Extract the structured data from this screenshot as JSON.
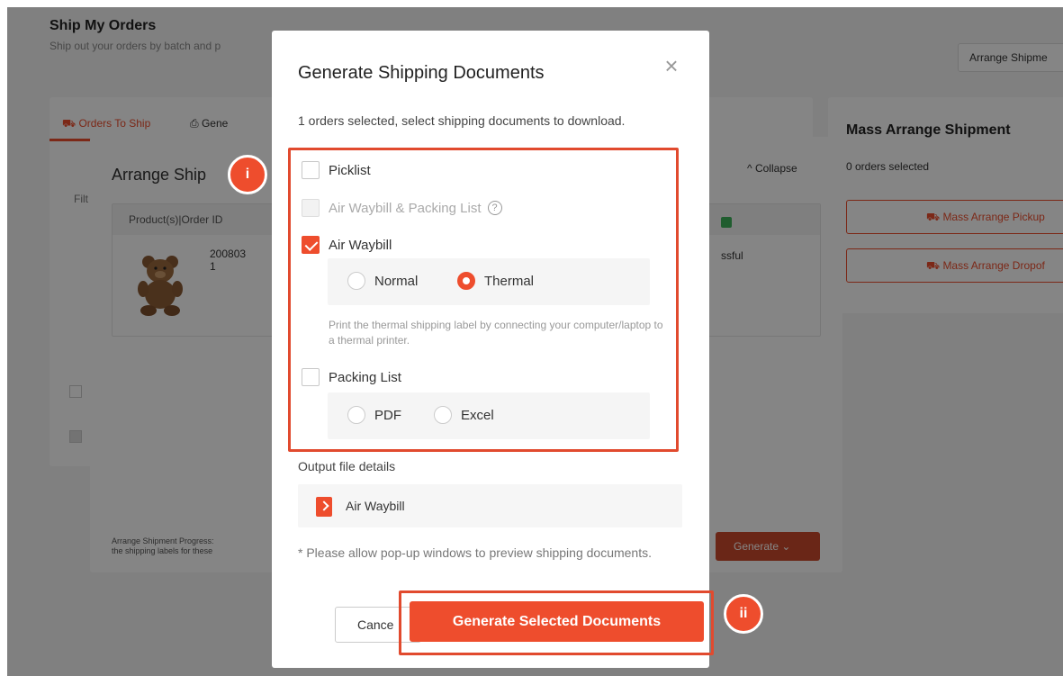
{
  "background": {
    "page_title": "Ship My Orders",
    "page_subtitle": "Ship out your orders by batch and p",
    "arrange_shipment_button": "Arrange Shipme",
    "tabs": [
      {
        "label": "Orders To Ship"
      },
      {
        "label": "Gene"
      }
    ],
    "mass_arrange": {
      "title": "Mass Arrange Shipment",
      "orders_selected": "0 orders selected",
      "pickup_button": "Mass Arrange Pickup",
      "dropoff_button": "Mass Arrange Dropof"
    },
    "arrange_modal": {
      "title": "Arrange Ship",
      "collapse_label": "Collapse",
      "filter_label": "Filt",
      "table_header": "Product(s)|Order ID",
      "order_id": "200803",
      "order_id_suffix": "1",
      "status": "ssful",
      "progress_text_line1": "Arrange Shipment Progress:",
      "progress_text_line2": "the shipping labels for these",
      "generate_button": "Generate"
    }
  },
  "dialog": {
    "title": "Generate Shipping Documents",
    "description": "1 orders selected, select shipping documents to download.",
    "options": {
      "picklist": {
        "label": "Picklist",
        "checked": false
      },
      "airway_packing": {
        "label": "Air Waybill & Packing List",
        "checked": false,
        "disabled": true
      },
      "air_waybill": {
        "label": "Air Waybill",
        "checked": true
      },
      "packing_list": {
        "label": "Packing List",
        "checked": false
      }
    },
    "air_waybill_formats": {
      "normal": "Normal",
      "thermal": "Thermal",
      "selected": "Thermal"
    },
    "thermal_hint": "Print the thermal shipping label by connecting your computer/laptop to a thermal printer.",
    "packing_list_formats": {
      "pdf": "PDF",
      "excel": "Excel"
    },
    "output_label": "Output file details",
    "output_file": "Air Waybill",
    "note": "* Please allow pop-up windows to preview shipping documents.",
    "cancel_button": "Cance",
    "generate_button": "Generate Selected Documents"
  },
  "markers": {
    "first": "i",
    "second": "ii"
  },
  "colors": {
    "brand": "#ee4d2d",
    "highlight_border": "#e14a2e",
    "overlay": "rgba(0,0,0,0.48)"
  }
}
